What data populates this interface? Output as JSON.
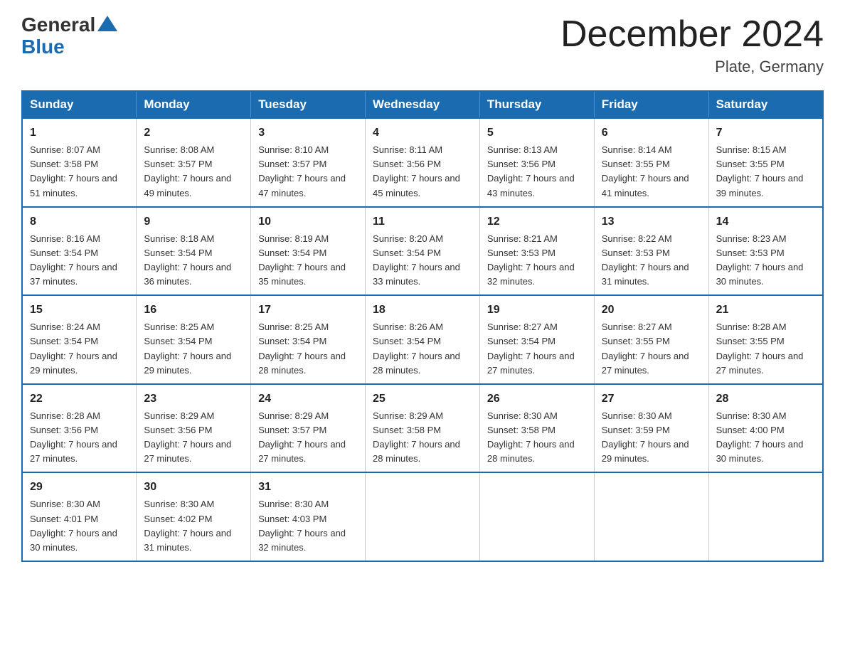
{
  "logo": {
    "general": "General",
    "blue": "Blue"
  },
  "title": "December 2024",
  "location": "Plate, Germany",
  "weekdays": [
    "Sunday",
    "Monday",
    "Tuesday",
    "Wednesday",
    "Thursday",
    "Friday",
    "Saturday"
  ],
  "weeks": [
    [
      {
        "day": "1",
        "sunrise": "8:07 AM",
        "sunset": "3:58 PM",
        "daylight": "7 hours and 51 minutes."
      },
      {
        "day": "2",
        "sunrise": "8:08 AM",
        "sunset": "3:57 PM",
        "daylight": "7 hours and 49 minutes."
      },
      {
        "day": "3",
        "sunrise": "8:10 AM",
        "sunset": "3:57 PM",
        "daylight": "7 hours and 47 minutes."
      },
      {
        "day": "4",
        "sunrise": "8:11 AM",
        "sunset": "3:56 PM",
        "daylight": "7 hours and 45 minutes."
      },
      {
        "day": "5",
        "sunrise": "8:13 AM",
        "sunset": "3:56 PM",
        "daylight": "7 hours and 43 minutes."
      },
      {
        "day": "6",
        "sunrise": "8:14 AM",
        "sunset": "3:55 PM",
        "daylight": "7 hours and 41 minutes."
      },
      {
        "day": "7",
        "sunrise": "8:15 AM",
        "sunset": "3:55 PM",
        "daylight": "7 hours and 39 minutes."
      }
    ],
    [
      {
        "day": "8",
        "sunrise": "8:16 AM",
        "sunset": "3:54 PM",
        "daylight": "7 hours and 37 minutes."
      },
      {
        "day": "9",
        "sunrise": "8:18 AM",
        "sunset": "3:54 PM",
        "daylight": "7 hours and 36 minutes."
      },
      {
        "day": "10",
        "sunrise": "8:19 AM",
        "sunset": "3:54 PM",
        "daylight": "7 hours and 35 minutes."
      },
      {
        "day": "11",
        "sunrise": "8:20 AM",
        "sunset": "3:54 PM",
        "daylight": "7 hours and 33 minutes."
      },
      {
        "day": "12",
        "sunrise": "8:21 AM",
        "sunset": "3:53 PM",
        "daylight": "7 hours and 32 minutes."
      },
      {
        "day": "13",
        "sunrise": "8:22 AM",
        "sunset": "3:53 PM",
        "daylight": "7 hours and 31 minutes."
      },
      {
        "day": "14",
        "sunrise": "8:23 AM",
        "sunset": "3:53 PM",
        "daylight": "7 hours and 30 minutes."
      }
    ],
    [
      {
        "day": "15",
        "sunrise": "8:24 AM",
        "sunset": "3:54 PM",
        "daylight": "7 hours and 29 minutes."
      },
      {
        "day": "16",
        "sunrise": "8:25 AM",
        "sunset": "3:54 PM",
        "daylight": "7 hours and 29 minutes."
      },
      {
        "day": "17",
        "sunrise": "8:25 AM",
        "sunset": "3:54 PM",
        "daylight": "7 hours and 28 minutes."
      },
      {
        "day": "18",
        "sunrise": "8:26 AM",
        "sunset": "3:54 PM",
        "daylight": "7 hours and 28 minutes."
      },
      {
        "day": "19",
        "sunrise": "8:27 AM",
        "sunset": "3:54 PM",
        "daylight": "7 hours and 27 minutes."
      },
      {
        "day": "20",
        "sunrise": "8:27 AM",
        "sunset": "3:55 PM",
        "daylight": "7 hours and 27 minutes."
      },
      {
        "day": "21",
        "sunrise": "8:28 AM",
        "sunset": "3:55 PM",
        "daylight": "7 hours and 27 minutes."
      }
    ],
    [
      {
        "day": "22",
        "sunrise": "8:28 AM",
        "sunset": "3:56 PM",
        "daylight": "7 hours and 27 minutes."
      },
      {
        "day": "23",
        "sunrise": "8:29 AM",
        "sunset": "3:56 PM",
        "daylight": "7 hours and 27 minutes."
      },
      {
        "day": "24",
        "sunrise": "8:29 AM",
        "sunset": "3:57 PM",
        "daylight": "7 hours and 27 minutes."
      },
      {
        "day": "25",
        "sunrise": "8:29 AM",
        "sunset": "3:58 PM",
        "daylight": "7 hours and 28 minutes."
      },
      {
        "day": "26",
        "sunrise": "8:30 AM",
        "sunset": "3:58 PM",
        "daylight": "7 hours and 28 minutes."
      },
      {
        "day": "27",
        "sunrise": "8:30 AM",
        "sunset": "3:59 PM",
        "daylight": "7 hours and 29 minutes."
      },
      {
        "day": "28",
        "sunrise": "8:30 AM",
        "sunset": "4:00 PM",
        "daylight": "7 hours and 30 minutes."
      }
    ],
    [
      {
        "day": "29",
        "sunrise": "8:30 AM",
        "sunset": "4:01 PM",
        "daylight": "7 hours and 30 minutes."
      },
      {
        "day": "30",
        "sunrise": "8:30 AM",
        "sunset": "4:02 PM",
        "daylight": "7 hours and 31 minutes."
      },
      {
        "day": "31",
        "sunrise": "8:30 AM",
        "sunset": "4:03 PM",
        "daylight": "7 hours and 32 minutes."
      },
      null,
      null,
      null,
      null
    ]
  ]
}
